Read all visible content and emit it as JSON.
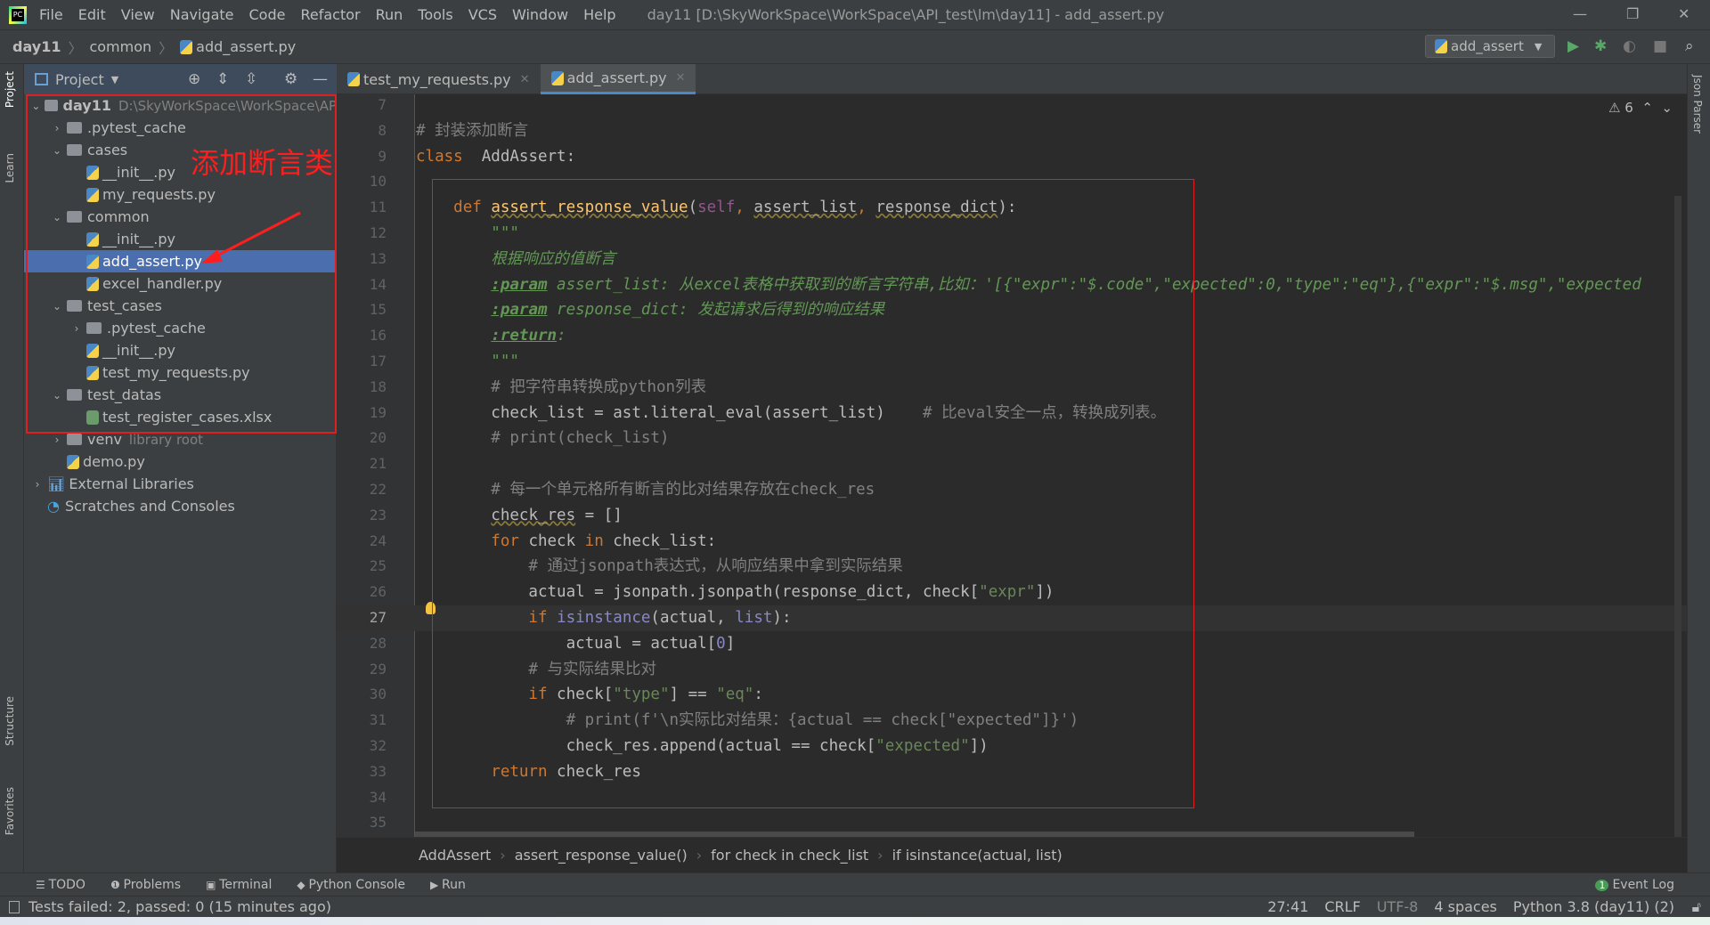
{
  "menubar": {
    "items": [
      "File",
      "Edit",
      "View",
      "Navigate",
      "Code",
      "Refactor",
      "Run",
      "Tools",
      "VCS",
      "Window",
      "Help"
    ],
    "title": "day11 [D:\\SkyWorkSpace\\WorkSpace\\API_test\\lm\\day11] - add_assert.py"
  },
  "navbar": {
    "crumbs": [
      "day11",
      "common",
      "add_assert.py"
    ],
    "run_config": "add_assert"
  },
  "left_strip": [
    "Project",
    "Learn",
    "Structure",
    "Favorites"
  ],
  "right_strip": [
    "Json Parser"
  ],
  "project": {
    "title": "Project",
    "tree": [
      {
        "label": "day11",
        "level": 0,
        "type": "folder",
        "expanded": true,
        "bold": true,
        "hint": "D:\\SkyWorkSpace\\WorkSpace\\AP"
      },
      {
        "label": ".pytest_cache",
        "level": 1,
        "type": "folder",
        "expanded": false
      },
      {
        "label": "cases",
        "level": 1,
        "type": "folder",
        "expanded": true
      },
      {
        "label": "__init__.py",
        "level": 2,
        "type": "py"
      },
      {
        "label": "my_requests.py",
        "level": 2,
        "type": "py"
      },
      {
        "label": "common",
        "level": 1,
        "type": "folder",
        "expanded": true
      },
      {
        "label": "__init__.py",
        "level": 2,
        "type": "py"
      },
      {
        "label": "add_assert.py",
        "level": 2,
        "type": "py",
        "selected": true
      },
      {
        "label": "excel_handler.py",
        "level": 2,
        "type": "py"
      },
      {
        "label": "test_cases",
        "level": 1,
        "type": "folder",
        "expanded": true
      },
      {
        "label": ".pytest_cache",
        "level": 2,
        "type": "folder",
        "expanded": false
      },
      {
        "label": "__init__.py",
        "level": 2,
        "type": "py"
      },
      {
        "label": "test_my_requests.py",
        "level": 2,
        "type": "py"
      },
      {
        "label": "test_datas",
        "level": 1,
        "type": "folder",
        "expanded": true
      },
      {
        "label": "test_register_cases.xlsx",
        "level": 2,
        "type": "file"
      },
      {
        "label": "venv",
        "level": 1,
        "type": "folder",
        "expanded": false,
        "hint": "library root"
      },
      {
        "label": "demo.py",
        "level": 1,
        "type": "py"
      },
      {
        "label": "External Libraries",
        "level": 0,
        "type": "lib",
        "expanded": false
      },
      {
        "label": "Scratches and Consoles",
        "level": 0,
        "type": "scratch"
      }
    ]
  },
  "annotation": "添加断言类",
  "tabs": [
    {
      "label": "test_my_requests.py",
      "active": false
    },
    {
      "label": "add_assert.py",
      "active": true
    }
  ],
  "warnings": "6",
  "current_line": 27,
  "code": [
    {
      "n": 7,
      "t": []
    },
    {
      "n": 8,
      "t": [
        [
          "cm",
          "# 封装添加断言"
        ]
      ]
    },
    {
      "n": 9,
      "t": [
        [
          "kw",
          "class"
        ],
        [
          "",
          "  AddAssert:"
        ]
      ]
    },
    {
      "n": 10,
      "t": []
    },
    {
      "n": 11,
      "t": [
        [
          "",
          "    "
        ],
        [
          "kw",
          "def"
        ],
        [
          "",
          " "
        ],
        [
          "fn",
          "assert_response_value"
        ],
        [
          "",
          "("
        ],
        [
          "sf",
          "self"
        ],
        [
          "kw",
          ", "
        ],
        [
          "un",
          "assert_list"
        ],
        [
          "kw",
          ", "
        ],
        [
          "un",
          "response_dict"
        ],
        [
          "",
          "):"
        ]
      ]
    },
    {
      "n": 12,
      "t": [
        [
          "doc",
          "        \"\"\""
        ]
      ]
    },
    {
      "n": 13,
      "t": [
        [
          "doc",
          "        根据响应的值断言"
        ]
      ]
    },
    {
      "n": 14,
      "t": [
        [
          "",
          "        "
        ],
        [
          "tag",
          ":param"
        ],
        [
          "doc",
          " assert_list: 从excel表格中获取到的断言字符串,比如：'[{\"expr\":\"$.code\",\"expected\":0,\"type\":\"eq\"},{\"expr\":\"$.msg\",\"expected"
        ]
      ]
    },
    {
      "n": 15,
      "t": [
        [
          "",
          "        "
        ],
        [
          "tag",
          ":param"
        ],
        [
          "doc",
          " response_dict: 发起请求后得到的响应结果"
        ]
      ]
    },
    {
      "n": 16,
      "t": [
        [
          "",
          "        "
        ],
        [
          "tag",
          ":return"
        ],
        [
          "doc",
          ":"
        ]
      ]
    },
    {
      "n": 17,
      "t": [
        [
          "doc",
          "        \"\"\""
        ]
      ]
    },
    {
      "n": 18,
      "t": [
        [
          "cm",
          "        # 把字符串转换成python列表"
        ]
      ]
    },
    {
      "n": 19,
      "t": [
        [
          "",
          "        check_list = ast.literal_eval(assert_list)    "
        ],
        [
          "cm",
          "# 比eval安全一点，转换成列表。"
        ]
      ]
    },
    {
      "n": 20,
      "t": [
        [
          "cm",
          "        # print(check_list)"
        ]
      ]
    },
    {
      "n": 21,
      "t": []
    },
    {
      "n": 22,
      "t": [
        [
          "cm",
          "        # 每一个单元格所有断言的比对结果存放在check_res"
        ]
      ]
    },
    {
      "n": 23,
      "t": [
        [
          "",
          "        "
        ],
        [
          "un",
          "check_res"
        ],
        [
          "",
          " = []"
        ]
      ]
    },
    {
      "n": 24,
      "t": [
        [
          "kw",
          "        for"
        ],
        [
          "",
          " check "
        ],
        [
          "kw",
          "in"
        ],
        [
          "",
          " check_list:"
        ]
      ]
    },
    {
      "n": 25,
      "t": [
        [
          "cm",
          "            # 通过jsonpath表达式，从响应结果中拿到实际结果"
        ]
      ]
    },
    {
      "n": 26,
      "t": [
        [
          "",
          "            actual = jsonpath.jsonpath(response_dict, check["
        ],
        [
          "st",
          "\"expr\""
        ],
        [
          "",
          "])"
        ]
      ]
    },
    {
      "n": 27,
      "t": [
        [
          "kw",
          "            if"
        ],
        [
          "",
          " "
        ],
        [
          "bi",
          "isinstance"
        ],
        [
          "",
          "(actual, "
        ],
        [
          "bi",
          "list"
        ],
        [
          "",
          "):"
        ]
      ]
    },
    {
      "n": 28,
      "t": [
        [
          "",
          "                actual = actual["
        ],
        [
          "bi",
          "0"
        ],
        [
          "",
          "]"
        ]
      ]
    },
    {
      "n": 29,
      "t": [
        [
          "cm",
          "            # 与实际结果比对"
        ]
      ]
    },
    {
      "n": 30,
      "t": [
        [
          "kw",
          "            if"
        ],
        [
          "",
          " check["
        ],
        [
          "st",
          "\"type\""
        ],
        [
          "",
          "] == "
        ],
        [
          "st",
          "\"eq\""
        ],
        [
          "",
          ":"
        ]
      ]
    },
    {
      "n": 31,
      "t": [
        [
          "cm",
          "                # print(f'\\n实际比对结果：{actual == check[\"expected\"]}')"
        ]
      ]
    },
    {
      "n": 32,
      "t": [
        [
          "",
          "                check_res.append(actual == check["
        ],
        [
          "st",
          "\"expected\""
        ],
        [
          "",
          "])"
        ]
      ]
    },
    {
      "n": 33,
      "t": [
        [
          "kw",
          "        return"
        ],
        [
          "",
          " check_res"
        ]
      ]
    },
    {
      "n": 34,
      "t": []
    },
    {
      "n": 35,
      "t": []
    }
  ],
  "editor_crumbs": [
    "AddAssert",
    "assert_response_value()",
    "for check in check_list",
    "if isinstance(actual, list)"
  ],
  "tool_windows": [
    "TODO",
    "Problems",
    "Terminal",
    "Python Console",
    "Run"
  ],
  "event_log": {
    "label": "Event Log",
    "count": "1"
  },
  "status": {
    "message": "Tests failed: 2, passed: 0 (15 minutes ago)",
    "position": "27:41",
    "line_sep": "CRLF",
    "encoding": "UTF-8",
    "indent": "4 spaces",
    "interpreter": "Python 3.8 (day11) (2)"
  }
}
